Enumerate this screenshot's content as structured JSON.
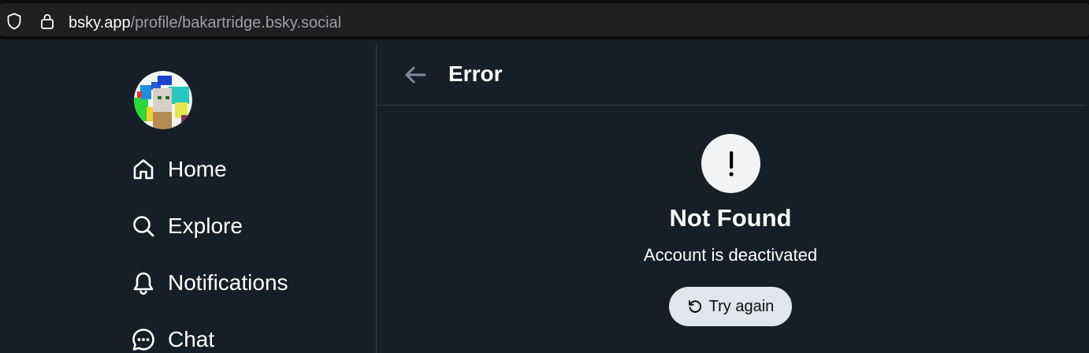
{
  "browser": {
    "url_host": "bsky.app",
    "url_path": "/profile/bakartridge.bsky.social"
  },
  "sidebar": {
    "items": [
      {
        "label": "Home",
        "icon": "home-icon"
      },
      {
        "label": "Explore",
        "icon": "search-icon"
      },
      {
        "label": "Notifications",
        "icon": "bell-icon"
      },
      {
        "label": "Chat",
        "icon": "chat-icon"
      }
    ]
  },
  "header": {
    "title": "Error",
    "back_icon": "arrow-left-icon"
  },
  "error": {
    "icon": "exclamation-icon",
    "title": "Not Found",
    "message": "Account is deactivated",
    "retry_label": "Try again",
    "retry_icon": "refresh-icon"
  },
  "colors": {
    "background": "#161e27",
    "divider": "#2e4052",
    "text": "#ffffff",
    "button_bg": "#e0e6ec",
    "back_arrow": "#7a8ea6"
  }
}
